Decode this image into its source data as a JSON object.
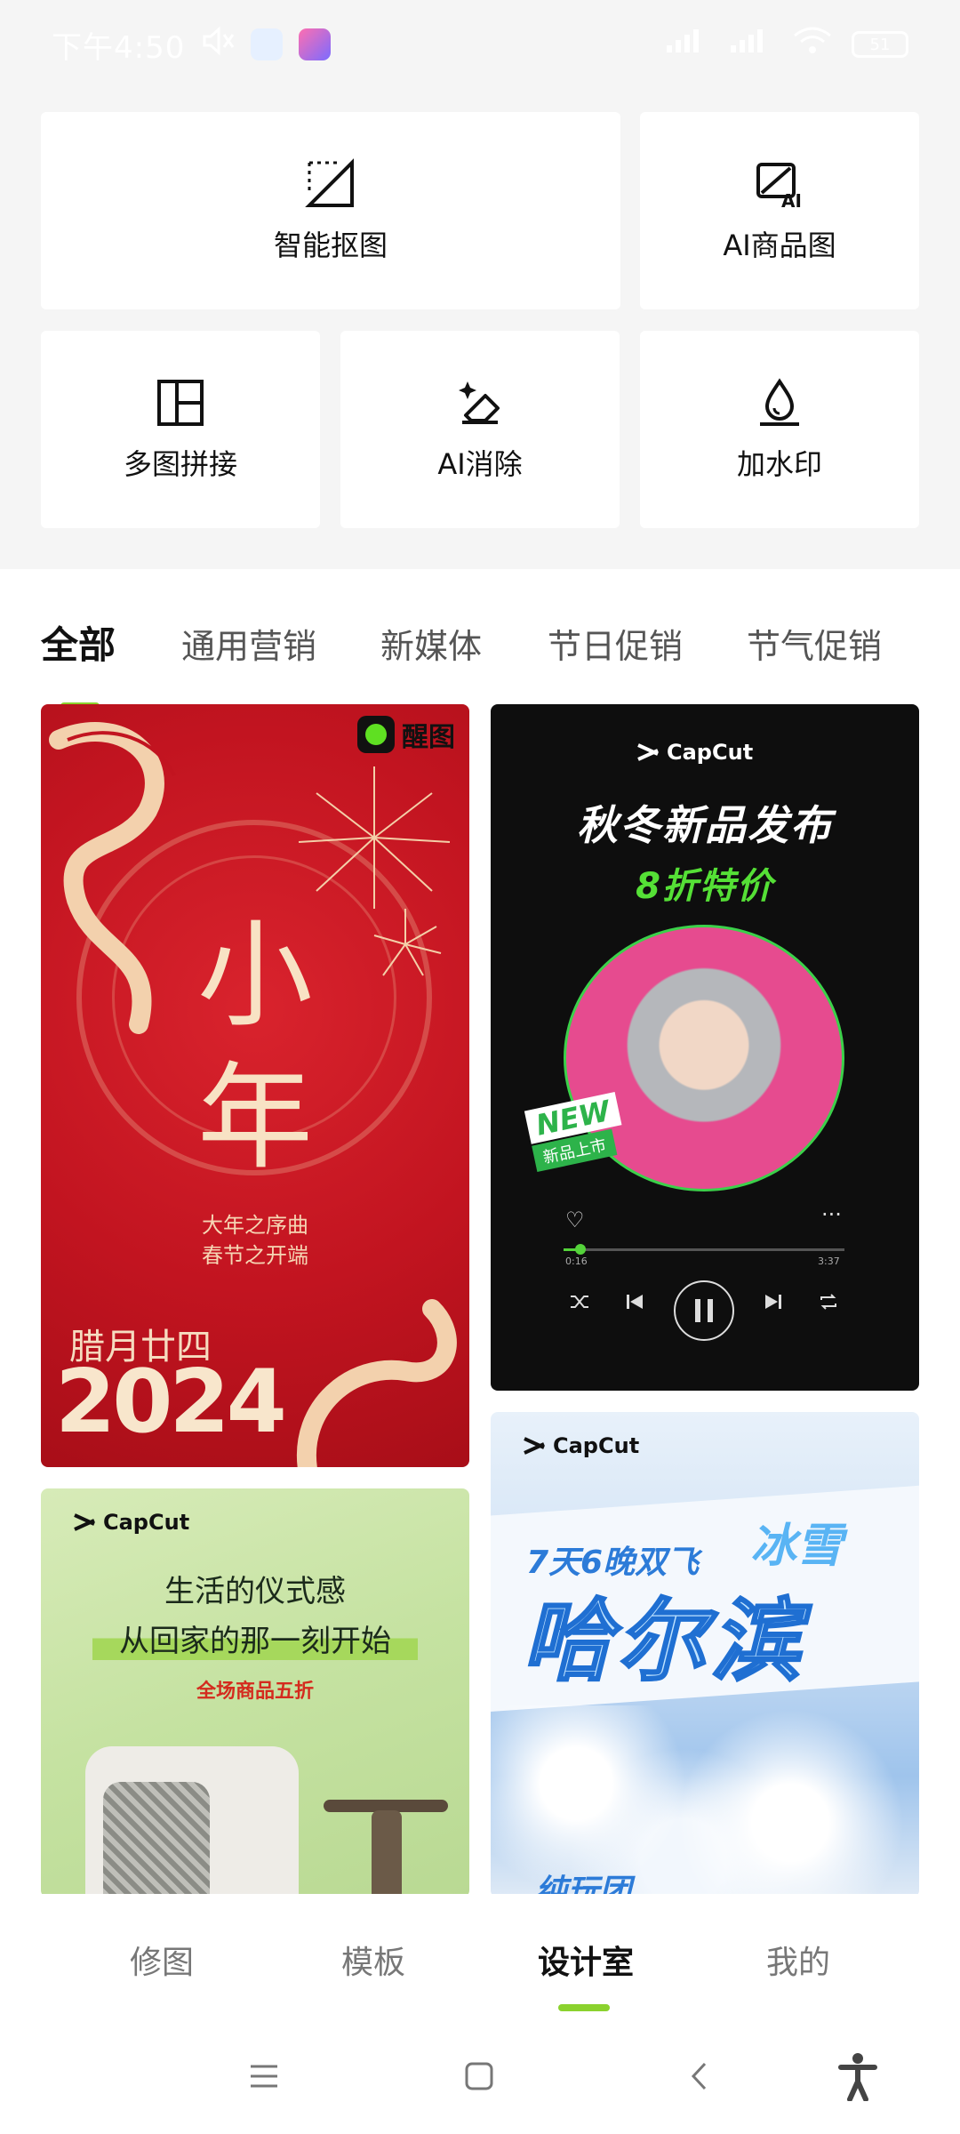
{
  "status_bar": {
    "time": "下午4:50",
    "battery": "51",
    "icons": [
      "mute-icon",
      "app-icon",
      "app-icon",
      "signal-icon",
      "signal-icon",
      "wifi-icon",
      "battery-icon"
    ]
  },
  "tools": [
    {
      "label": "智能抠图",
      "icon": "smart-cutout-icon"
    },
    {
      "label": "AI商品图",
      "icon": "ai-product-image-icon"
    },
    {
      "label": "多图拼接",
      "icon": "collage-icon"
    },
    {
      "label": "AI消除",
      "icon": "ai-eraser-icon"
    },
    {
      "label": "加水印",
      "icon": "watermark-icon"
    }
  ],
  "tabs": [
    "全部",
    "通用营销",
    "新媒体",
    "节日促销",
    "节气促销"
  ],
  "active_tab": "全部",
  "templates": {
    "t1": {
      "logo": "醒图",
      "big1": "小",
      "big2": "年",
      "sub1": "大年之序曲",
      "sub2": "春节之开端",
      "date": "腊月廿四",
      "year": "2024"
    },
    "t2": {
      "brand": "CapCut",
      "title": "秋冬新品发布",
      "subtitle": "8折特价",
      "badge": "NEW",
      "badge_sub": "新品上市",
      "time_start": "0:16",
      "time_end": "3:37",
      "progress": 0.06
    },
    "t3": {
      "brand": "CapCut",
      "line1": "生活的仪式感",
      "line2": "从回家的那一刻开始",
      "line3": "全场商品五折"
    },
    "t4": {
      "brand": "CapCut",
      "line1": "7天6晚双飞",
      "line1b": "冰雪",
      "big": "哈尔滨",
      "foot": "纯玩团"
    }
  },
  "bottom_nav": [
    "修图",
    "模板",
    "设计室",
    "我的"
  ],
  "bottom_nav_active": "设计室",
  "colors": {
    "accent": "#8bd22e",
    "background": "#f5f5f5",
    "card": "#ffffff"
  }
}
